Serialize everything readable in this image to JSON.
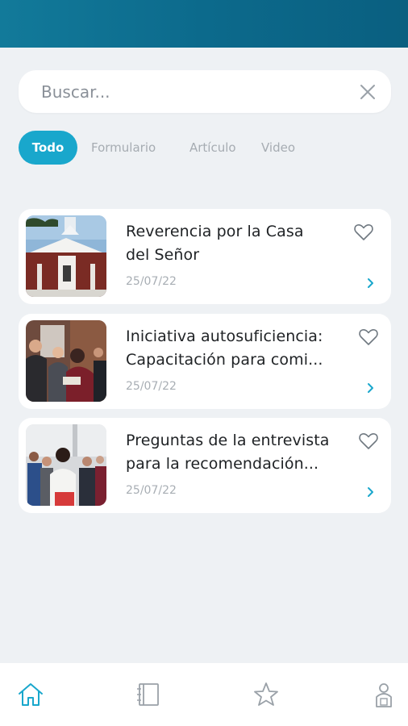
{
  "search": {
    "placeholder": "Buscar..."
  },
  "filters": [
    {
      "label": "Todo",
      "active": true
    },
    {
      "label": "Formulario",
      "active": false
    },
    {
      "label": "Artículo",
      "active": false
    },
    {
      "label": "Video",
      "active": false
    }
  ],
  "items": [
    {
      "title": "Reverencia por la Casa\ndel Señor",
      "date": "25/07/22"
    },
    {
      "title": "Iniciativa autosuficiencia:\nCapacitación para comi...",
      "date": "25/07/22"
    },
    {
      "title": "Preguntas de la entrevista\npara la recomendación...",
      "date": "25/07/22"
    }
  ],
  "bottom_nav": [
    {
      "icon": "home-icon",
      "active": true
    },
    {
      "icon": "notebook-icon",
      "active": false
    },
    {
      "icon": "star-icon",
      "active": false
    },
    {
      "icon": "profile-badge-icon",
      "active": false
    }
  ],
  "colors": {
    "header": "#0c6a8c",
    "accent": "#19a7cc",
    "background": "#eef1f4"
  }
}
